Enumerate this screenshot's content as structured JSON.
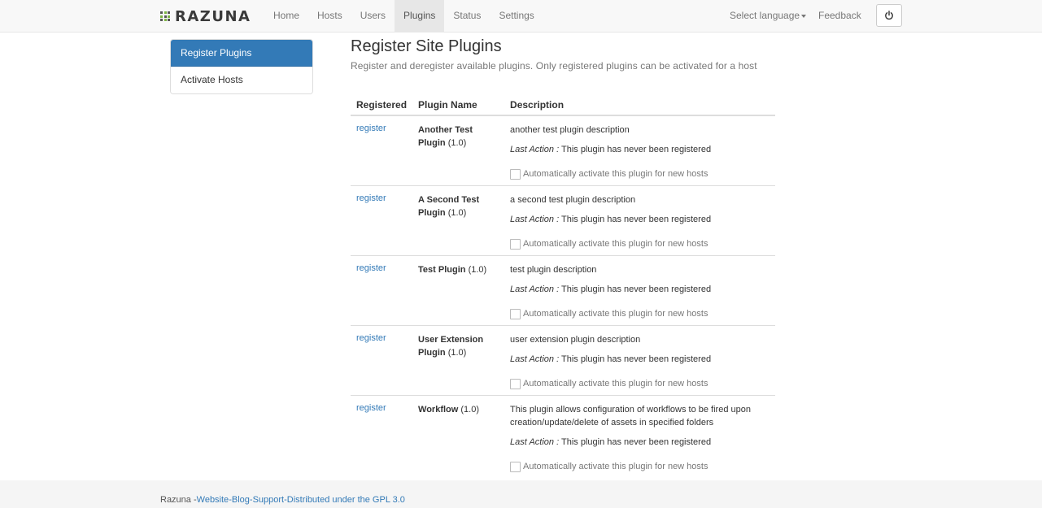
{
  "brand": {
    "name": "RAZUNA"
  },
  "nav": {
    "items": [
      "Home",
      "Hosts",
      "Users",
      "Plugins",
      "Status",
      "Settings"
    ],
    "active": "Plugins",
    "language_label": "Select language",
    "feedback_label": "Feedback"
  },
  "sidebar": {
    "items": [
      {
        "label": "Register Plugins",
        "active": true
      },
      {
        "label": "Activate Hosts",
        "active": false
      }
    ]
  },
  "main": {
    "title": "Register Site Plugins",
    "subtitle": "Register and deregister available plugins. Only registered plugins can be activated for a host",
    "columns": [
      "Registered",
      "Plugin Name",
      "Description"
    ],
    "last_action_label": "Last Action :",
    "auto_activate_label": "Automatically activate this plugin for new hosts",
    "plugins": [
      {
        "action": "register",
        "name": "Another Test Plugin",
        "version": "(1.0)",
        "description": "another test plugin description",
        "last_action": "This plugin has never been registered"
      },
      {
        "action": "register",
        "name": "A Second Test Plugin",
        "version": "(1.0)",
        "description": "a second test plugin description",
        "last_action": "This plugin has never been registered"
      },
      {
        "action": "register",
        "name": "Test Plugin",
        "version": "(1.0)",
        "description": "test plugin description",
        "last_action": "This plugin has never been registered"
      },
      {
        "action": "register",
        "name": "User Extension Plugin",
        "version": "(1.0)",
        "description": "user extension plugin description",
        "last_action": "This plugin has never been registered"
      },
      {
        "action": "register",
        "name": "Workflow",
        "version": "(1.0)",
        "description": "This plugin allows configuration of workflows to be fired upon creation/update/delete of assets in specified folders",
        "last_action": "This plugin has never been registered"
      }
    ]
  },
  "footer": {
    "prefix": "Razuna -",
    "links": [
      "Website",
      "Blog",
      "Support"
    ],
    "suffix": "Distributed under the GPL 3.0"
  }
}
